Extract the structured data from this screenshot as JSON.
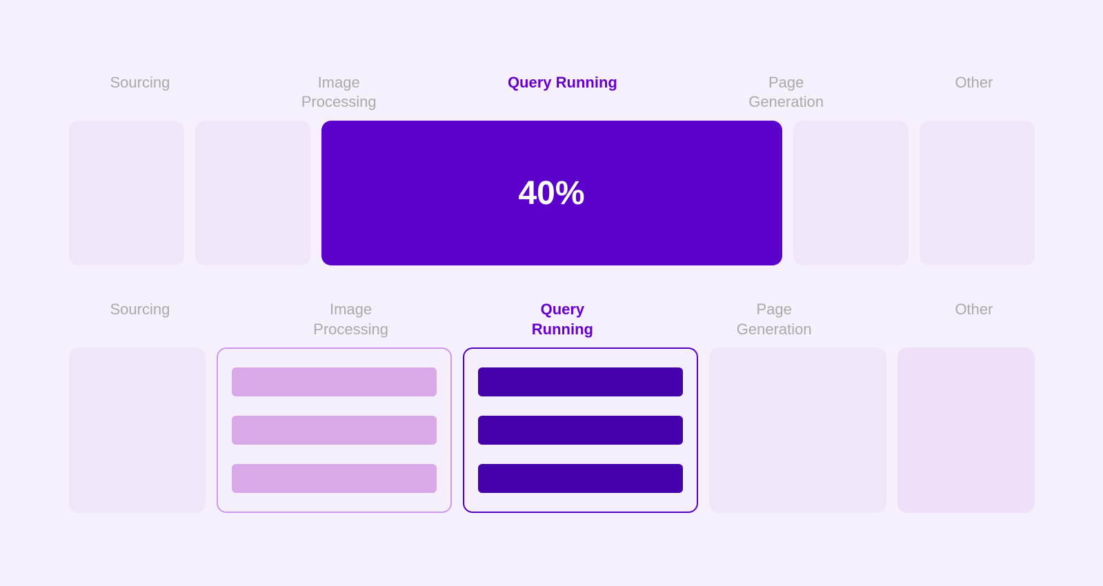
{
  "top": {
    "labels": [
      {
        "id": "sourcing",
        "text": "Sourcing",
        "active": false
      },
      {
        "id": "image-processing",
        "text": "Image\nProcessing",
        "active": false
      },
      {
        "id": "query-running",
        "text": "Query Running",
        "active": true
      },
      {
        "id": "page-generation",
        "text": "Page\nGeneration",
        "active": false
      },
      {
        "id": "other",
        "text": "Other",
        "active": false
      }
    ],
    "active_percent": "40%"
  },
  "bottom": {
    "labels": [
      {
        "id": "sourcing",
        "text": "Sourcing",
        "active": false
      },
      {
        "id": "image-processing",
        "text": "Image\nProcessing",
        "active": false
      },
      {
        "id": "query-running",
        "text": "Query\nRunning",
        "active": true
      },
      {
        "id": "page-generation",
        "text": "Page\nGeneration",
        "active": false
      },
      {
        "id": "other",
        "text": "Other",
        "active": false
      }
    ]
  }
}
